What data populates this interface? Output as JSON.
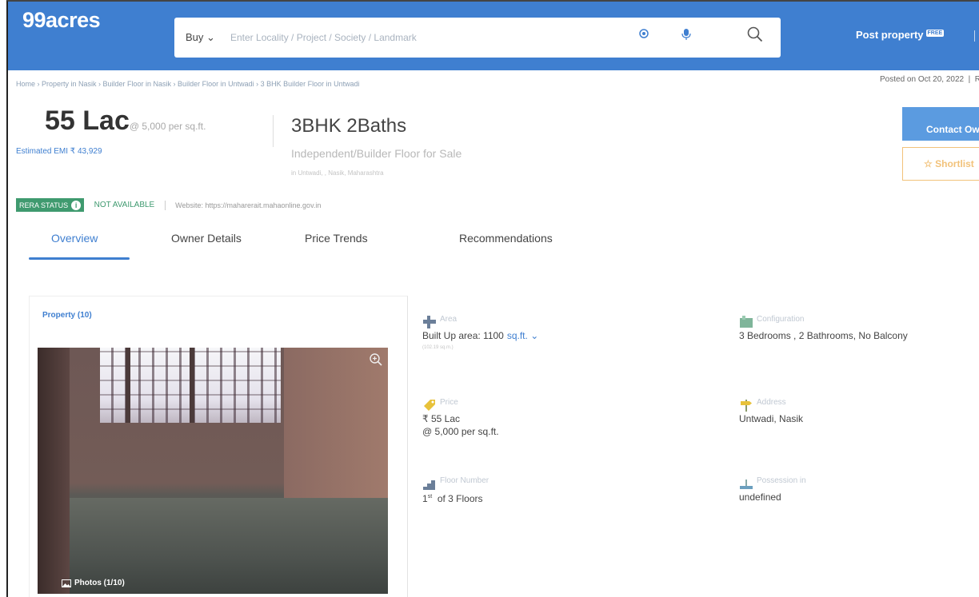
{
  "header": {
    "logo": "99acres",
    "buy_label": "Buy",
    "search_placeholder": "Enter Locality / Project / Society / Landmark",
    "post_property_label": "Post property",
    "free_badge": "FREE",
    "accent_color": "#3f7fd0"
  },
  "breadcrumb": "Home › Property in Nasik › Builder Floor in Nasik › Builder Floor in Untwadi › 3 BHK Builder Floor in Untwadi",
  "posted_on": "Posted on Oct 20, 2022",
  "listing": {
    "price": "55 Lac",
    "price_rate": "@ 5,000 per sq.ft.",
    "emi": "Estimated EMI ₹ 43,929",
    "title": "3BHK 2Baths",
    "subtitle": "Independent/Builder Floor for Sale",
    "location": "in Untwadi, , Nasik, Maharashtra"
  },
  "actions": {
    "contact_label": "Contact Owner",
    "shortlist_label": "Shortlist"
  },
  "rera": {
    "badge_label": "RERA STATUS",
    "status": "NOT AVAILABLE",
    "website": "Website: https://maharerait.mahaonline.gov.in"
  },
  "tabs": [
    "Overview",
    "Owner Details",
    "Price Trends",
    "Recommendations"
  ],
  "card": {
    "label": "Property (10)",
    "photos_label": "Photos (1/10)"
  },
  "details": {
    "area": {
      "label": "Area",
      "value": "Built Up area: 1100",
      "unit": "sq.ft.",
      "sub": "(102.19 sq.m.)"
    },
    "configuration": {
      "label": "Configuration",
      "value": "3 Bedrooms , 2 Bathrooms, No Balcony"
    },
    "price": {
      "label": "Price",
      "value": "₹ 55 Lac",
      "sub": "@ 5,000 per sq.ft."
    },
    "address": {
      "label": "Address",
      "value": "Untwadi, Nasik"
    },
    "floor": {
      "label": "Floor Number",
      "value_num": "1",
      "value_sup": "st",
      "value_rest": "of 3 Floors"
    },
    "possession": {
      "label": "Possession in",
      "value": "undefined"
    }
  }
}
